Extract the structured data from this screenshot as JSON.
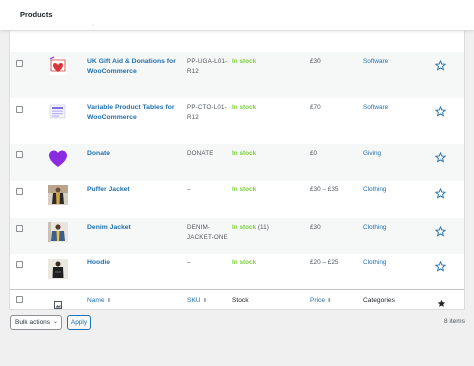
{
  "header": {
    "title": "Products",
    "partial": "·"
  },
  "products": [
    {
      "name": "UK Gift Aid & Donations for WooCommerce",
      "sku": "PP-UGA-L01-R12",
      "stock": "In stock",
      "stock_qty": "",
      "price": "£30",
      "category": "Software",
      "thumb": "gift-aid-logo"
    },
    {
      "name": "Variable Product Tables for WooCommerce",
      "sku": "PP-CTO-L01-R12",
      "stock": "In stock",
      "stock_qty": "",
      "price": "£70",
      "category": "Software",
      "thumb": "table-logo"
    },
    {
      "name": "Donate",
      "sku": "DONATE",
      "stock": "In stock",
      "stock_qty": "",
      "price": "£0",
      "category": "Giving",
      "thumb": "purple-heart"
    },
    {
      "name": "Puffer Jacket",
      "sku": "–",
      "stock": "In stock",
      "stock_qty": "",
      "price": "£30 – £35",
      "category": "Clothing",
      "thumb": "puffer-jacket-photo"
    },
    {
      "name": "Denim Jacket",
      "sku": "DENIM-JACKET-ONE",
      "stock": "In stock",
      "stock_qty": " (11)",
      "price": "£30",
      "category": "Clothing",
      "thumb": "denim-jacket-photo"
    },
    {
      "name": "Hoodie",
      "sku": "–",
      "stock": "In stock",
      "stock_qty": "",
      "price": "£20 – £25",
      "category": "Clothing",
      "thumb": "hoodie-photo"
    }
  ],
  "table_footer": {
    "image_icon": "image-icon",
    "name": "Name",
    "sku": "SKU",
    "stock": "Stock",
    "price": "Price",
    "categories": "Categories",
    "featured_icon": "star-icon",
    "sort_glyph": "⬍"
  },
  "bulk_actions": {
    "label": "Bulk actions",
    "apply": "Apply"
  },
  "items_count": "8 items",
  "colors": {
    "link": "#2271b1",
    "in_stock": "#7ad03a",
    "heart": "#8a2be2"
  }
}
